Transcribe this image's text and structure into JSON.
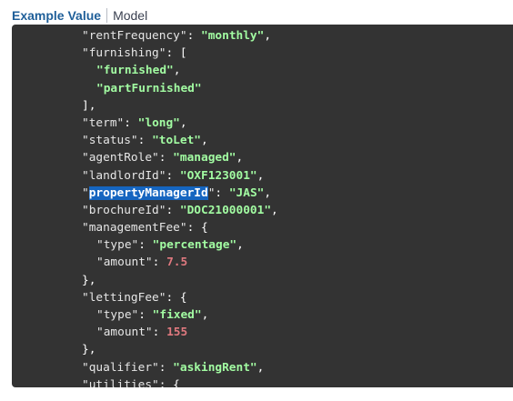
{
  "tabs": {
    "example_value": "Example Value",
    "model": "Model"
  },
  "code": {
    "partial_top": "\"rentFrequency\": \"monthly\",",
    "lines": [
      {
        "indent": 1,
        "key": "\"rentFrequency\"",
        "sep": ": ",
        "value": "\"monthly\"",
        "vtype": "str",
        "tail": ","
      },
      {
        "indent": 1,
        "key": "\"furnishing\"",
        "sep": ": ",
        "value": "",
        "vtype": "",
        "tail": "["
      },
      {
        "indent": 2,
        "key": "",
        "sep": "",
        "value": "\"furnished\"",
        "vtype": "str",
        "tail": ","
      },
      {
        "indent": 2,
        "key": "",
        "sep": "",
        "value": "\"partFurnished\"",
        "vtype": "str",
        "tail": ""
      },
      {
        "indent": 1,
        "key": "",
        "sep": "",
        "value": "",
        "vtype": "",
        "tail": "],"
      },
      {
        "indent": 1,
        "key": "\"term\"",
        "sep": ": ",
        "value": "\"long\"",
        "vtype": "str",
        "tail": ","
      },
      {
        "indent": 1,
        "key": "\"status\"",
        "sep": ": ",
        "value": "\"toLet\"",
        "vtype": "str",
        "tail": ","
      },
      {
        "indent": 1,
        "key": "\"agentRole\"",
        "sep": ": ",
        "value": "\"managed\"",
        "vtype": "str",
        "tail": ","
      },
      {
        "indent": 1,
        "key": "\"landlordId\"",
        "sep": ": ",
        "value": "\"OXF123001\"",
        "vtype": "str",
        "tail": ","
      },
      {
        "indent": 1,
        "key_quote_open": "\"",
        "key_highlighted": "propertyManagerId",
        "key_quote_close": "\"",
        "sep": ": ",
        "value": "\"JAS\"",
        "vtype": "str",
        "tail": ",",
        "highlight": true
      },
      {
        "indent": 1,
        "key": "\"brochureId\"",
        "sep": ": ",
        "value": "\"DOC21000001\"",
        "vtype": "str",
        "tail": ","
      },
      {
        "indent": 1,
        "key": "\"managementFee\"",
        "sep": ": ",
        "value": "",
        "vtype": "",
        "tail": "{"
      },
      {
        "indent": 2,
        "key": "\"type\"",
        "sep": ": ",
        "value": "\"percentage\"",
        "vtype": "str",
        "tail": ","
      },
      {
        "indent": 2,
        "key": "\"amount\"",
        "sep": ": ",
        "value": "7.5",
        "vtype": "num",
        "tail": ""
      },
      {
        "indent": 1,
        "key": "",
        "sep": "",
        "value": "",
        "vtype": "",
        "tail": "},"
      },
      {
        "indent": 1,
        "key": "\"lettingFee\"",
        "sep": ": ",
        "value": "",
        "vtype": "",
        "tail": "{"
      },
      {
        "indent": 2,
        "key": "\"type\"",
        "sep": ": ",
        "value": "\"fixed\"",
        "vtype": "str",
        "tail": ","
      },
      {
        "indent": 2,
        "key": "\"amount\"",
        "sep": ": ",
        "value": "155",
        "vtype": "num",
        "tail": ""
      },
      {
        "indent": 1,
        "key": "",
        "sep": "",
        "value": "",
        "vtype": "",
        "tail": "},"
      },
      {
        "indent": 1,
        "key": "\"qualifier\"",
        "sep": ": ",
        "value": "\"askingRent\"",
        "vtype": "str",
        "tail": ","
      },
      {
        "indent": 1,
        "key": "\"utilities\"",
        "sep": ": ",
        "value": "",
        "vtype": "",
        "tail": "{"
      }
    ]
  },
  "colors": {
    "panel_bg": "#333333",
    "string_value": "#a2fca2",
    "number_value": "#e0797f",
    "selection": "#1565c0",
    "active_tab": "#1f5f99"
  }
}
